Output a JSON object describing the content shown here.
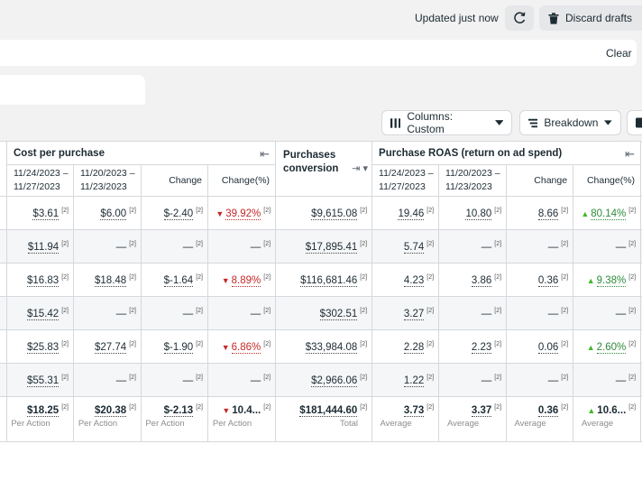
{
  "topbar": {
    "updated": "Updated just now",
    "discard": "Discard drafts"
  },
  "filter": {
    "clear": "Clear"
  },
  "toolbar": {
    "columns": "Columns: Custom",
    "breakdown": "Breakdown"
  },
  "groups": {
    "cpp": "Cost per purchase",
    "pcv": "Purchases conversion value",
    "roas": "Purchase ROAS (return on ad spend)"
  },
  "headers": {
    "range_a": "11/24/2023 –",
    "range_a2": "11/27/2023",
    "range_b": "11/20/2023 –",
    "range_b2": "11/23/2023",
    "change": "Change",
    "change_pct": "Change(%)"
  },
  "rows": [
    {
      "cpp_a": "$3.61",
      "cpp_b": "$6.00",
      "cpp_chg": "$-2.40",
      "cpp_pct": "39.92%",
      "pcv": "$9,615.08",
      "roas_a": "19.46",
      "roas_b": "10.80",
      "roas_chg": "8.66",
      "roas_pct": "80.14%"
    },
    {
      "cpp_a": "$11.94",
      "cpp_b": "—",
      "cpp_chg": "—",
      "cpp_pct": "—",
      "pcv": "$17,895.41",
      "roas_a": "5.74",
      "roas_b": "—",
      "roas_chg": "—",
      "roas_pct": "—"
    },
    {
      "cpp_a": "$16.83",
      "cpp_b": "$18.48",
      "cpp_chg": "$-1.64",
      "cpp_pct": "8.89%",
      "pcv": "$116,681.46",
      "roas_a": "4.23",
      "roas_b": "3.86",
      "roas_chg": "0.36",
      "roas_pct": "9.38%"
    },
    {
      "cpp_a": "$15.42",
      "cpp_b": "—",
      "cpp_chg": "—",
      "cpp_pct": "—",
      "pcv": "$302.51",
      "roas_a": "3.27",
      "roas_b": "—",
      "roas_chg": "—",
      "roas_pct": "—"
    },
    {
      "cpp_a": "$25.83",
      "cpp_b": "$27.74",
      "cpp_chg": "$-1.90",
      "cpp_pct": "6.86%",
      "pcv": "$33,984.08",
      "roas_a": "2.28",
      "roas_b": "2.23",
      "roas_chg": "0.06",
      "roas_pct": "2.60%"
    },
    {
      "cpp_a": "$55.31",
      "cpp_b": "—",
      "cpp_chg": "—",
      "cpp_pct": "—",
      "pcv": "$2,966.06",
      "roas_a": "1.22",
      "roas_b": "—",
      "roas_chg": "—",
      "roas_pct": "—"
    }
  ],
  "totals": {
    "cpp_a": "$18.25",
    "cpp_b": "$20.38",
    "cpp_chg": "$-2.13",
    "cpp_pct": "10.4...",
    "pcv": "$181,444.60",
    "roas_a": "3.73",
    "roas_b": "3.37",
    "roas_chg": "0.36",
    "roas_pct": "10.6...",
    "per_action": "Per Action",
    "total": "Total",
    "average": "Average"
  },
  "info_marker": "[2]",
  "colors": {
    "negative": "#c62828",
    "positive": "#2e8b3a",
    "up_arrow": "#42b72a",
    "border": "#d5d8dc"
  },
  "icons": {
    "refresh": "refresh-icon",
    "trash": "trash-icon",
    "columns": "columns-icon",
    "breakdown": "breakdown-icon",
    "collapse": "collapse-column-icon",
    "trend_down": "trend-down-icon",
    "trend_up": "trend-up-icon"
  }
}
